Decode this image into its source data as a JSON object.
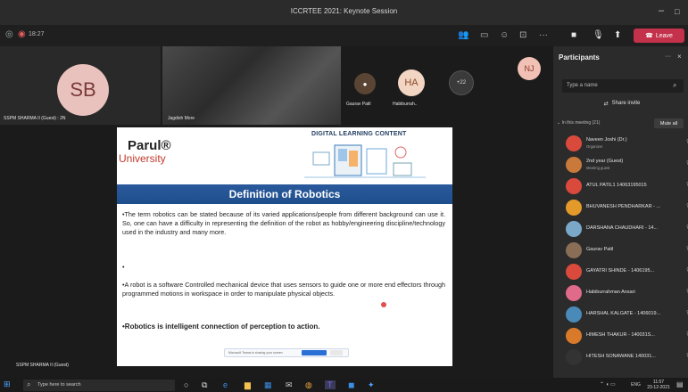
{
  "window": {
    "title": "ICCRTEE 2021: Keynote Session",
    "minimize": "–",
    "restore": "□"
  },
  "meeting": {
    "timer": "18:27",
    "leave_label": "Leave"
  },
  "stage": {
    "tiles": [
      {
        "initials": "SB",
        "label": "SSPM SHARMA II (Guest) : 2N",
        "color": "#e9c2be"
      },
      {
        "name": "Jagdish More",
        "label": "Jagdish More"
      },
      {
        "name": "Gaurav Patil",
        "label": "Gaurav Patil"
      },
      {
        "initials": "HA",
        "label": "Habiburrah..",
        "color": "#f2d5c2"
      },
      {
        "overflow": "+22"
      },
      {
        "initials": "NJ",
        "color": "#f2c1b6"
      }
    ],
    "bottom_label": "SSPM SHARMA II (Guest)"
  },
  "slide": {
    "brand_line1": "Parul®",
    "brand_line2": "University",
    "tag": "DIGITAL LEARNING CONTENT",
    "title": "Definition of Robotics",
    "para1": "•The term robotics can be stated because of its varied applications/people from different background can use it. So, one can have a difficulty in representing the definition of the robot as hobby/engineering discipline/technology used in the industry and many more.",
    "bullet_empty": "•",
    "para2": "•A robot is a software Controlled mechanical device that uses sensors to guide one or more end effectors through programmed motions in workspace in order to manipulate physical objects.",
    "bold_line": "•Robotics is intelligent connection of perception to action.",
    "share_bar_text": "Microsoft Teams is sharing your screen"
  },
  "participants": {
    "header": "Participants",
    "search_placeholder": "Type a name",
    "share_invite": "Share invite",
    "section_label": "In this meeting (21)",
    "mute_all": "Mute all",
    "list": [
      {
        "name": "Naveen Joshi (Dr.)",
        "sub": "Organizer",
        "color": "#d94a3d"
      },
      {
        "name": "2nd year (Guest)",
        "sub": "Meeting guest",
        "color": "#c9793a"
      },
      {
        "name": "ATUL PATIL1 14063195015",
        "sub": "",
        "color": "#d94a3d"
      },
      {
        "name": "BHUVANESH PENDHARKAR - ...",
        "sub": "",
        "color": "#e49a2a"
      },
      {
        "name": "DARSHANA CHAUDHARI - 14...",
        "sub": "",
        "color": "#7aa8c8"
      },
      {
        "name": "Gaurav Patil",
        "sub": "",
        "color": "#8a6d55"
      },
      {
        "name": "GAYATRI SHINDE - 1406195...",
        "sub": "",
        "color": "#d94a3d"
      },
      {
        "name": "Habiburrahman Ansari",
        "sub": "",
        "color": "#e06a8a"
      },
      {
        "name": "HARSHAL KALGATE - 1406019...",
        "sub": "",
        "color": "#4a8ab8"
      },
      {
        "name": "HIMESH THAKUR - 140031S...",
        "sub": "",
        "color": "#d97a2a"
      },
      {
        "name": "HITESH SONAWANE 140031...",
        "sub": "",
        "color": "#333333"
      }
    ]
  },
  "taskbar": {
    "search_placeholder": "Type here to search",
    "time": "11:57",
    "date": "23-12-2021",
    "lang": "ENG"
  }
}
